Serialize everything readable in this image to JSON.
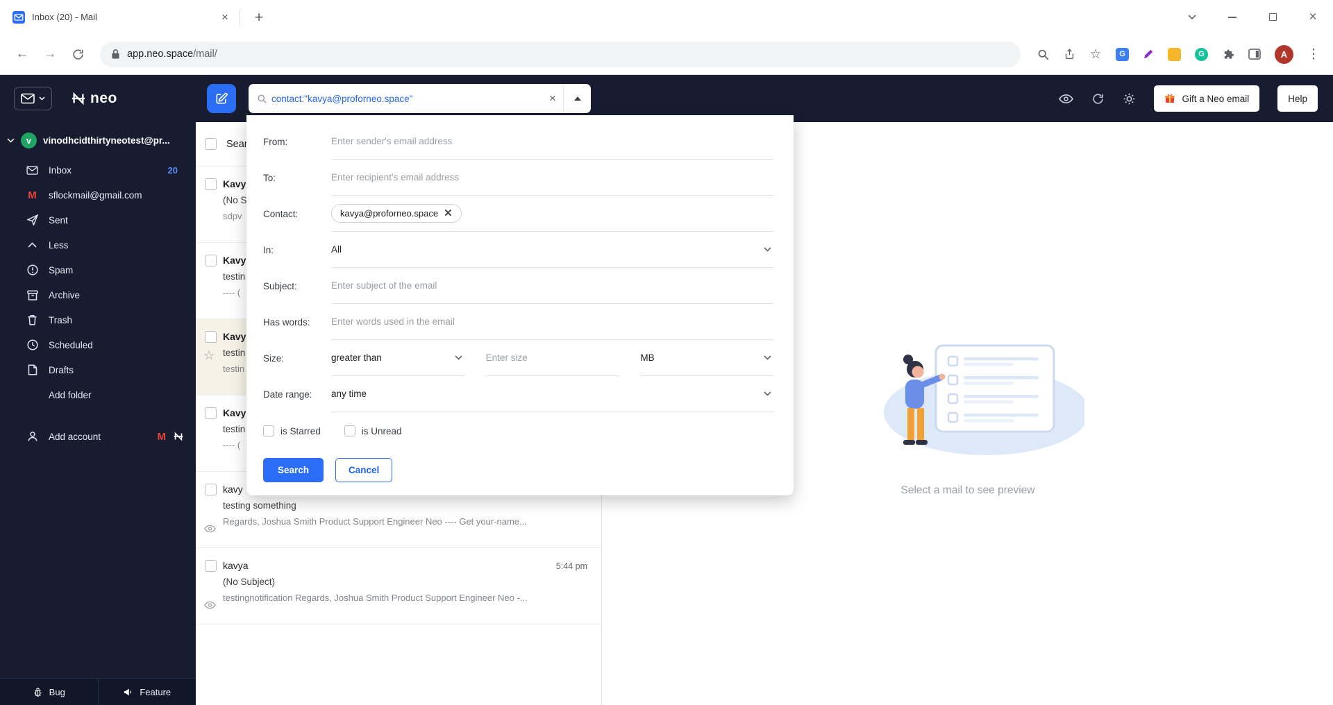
{
  "browser": {
    "tab_title": "Inbox (20) - Mail",
    "url_domain": "app.neo.space",
    "url_path": "/mail/",
    "profile_letter": "A"
  },
  "header": {
    "logo_text": "neo",
    "search_query": "contact:\"kavya@proforneo.space\"",
    "gift_button_label": "Gift a Neo email",
    "help_button_label": "Help"
  },
  "sidebar": {
    "account_email": "vinodhcidthirtyneotest@pr...",
    "account_avatar_letter": "v",
    "items": [
      {
        "label": "Inbox",
        "badge": "20"
      },
      {
        "label": "sflockmail@gmail.com"
      },
      {
        "label": "Sent"
      },
      {
        "label": "Less"
      },
      {
        "label": "Spam"
      },
      {
        "label": "Archive"
      },
      {
        "label": "Trash"
      },
      {
        "label": "Scheduled"
      },
      {
        "label": "Drafts"
      },
      {
        "label": "Add folder"
      }
    ],
    "add_account_label": "Add account",
    "bug_label": "Bug",
    "feature_label": "Feature"
  },
  "mail_list": {
    "header_label": "Sear",
    "rows": [
      {
        "sender": "Kavy",
        "subject": "(No S",
        "snippet": "sdpv"
      },
      {
        "sender": "Kavy",
        "subject": "testin",
        "snippet": "---- ("
      },
      {
        "sender": "Kavy",
        "subject": "testin",
        "snippet": "testin",
        "selected": true,
        "starred": true
      },
      {
        "sender": "Kavy",
        "subject": "testin",
        "snippet": "---- ("
      },
      {
        "sender": "kavy",
        "subject": "testing something",
        "snippet": "Regards, Joshua Smith Product Support Engineer Neo ---- Get your-name...",
        "read_receipt": true
      },
      {
        "sender": "kavya",
        "subject": "(No Subject)",
        "snippet": "testingnotification Regards, Joshua Smith Product Support Engineer Neo -...",
        "time": "5:44 pm",
        "read_receipt": true
      }
    ]
  },
  "search_panel": {
    "from_label": "From:",
    "from_placeholder": "Enter sender's email address",
    "to_label": "To:",
    "to_placeholder": "Enter recipient's email address",
    "contact_label": "Contact:",
    "contact_chip": "kavya@proforneo.space",
    "in_label": "In:",
    "in_value": "All",
    "subject_label": "Subject:",
    "subject_placeholder": "Enter subject of the email",
    "haswords_label": "Has words:",
    "haswords_placeholder": "Enter words used in the email",
    "size_label": "Size:",
    "size_operator": "greater than",
    "size_placeholder": "Enter size",
    "size_unit": "MB",
    "daterange_label": "Date range:",
    "daterange_value": "any time",
    "starred_label": "is Starred",
    "unread_label": "is Unread",
    "search_button": "Search",
    "cancel_button": "Cancel"
  },
  "preview": {
    "empty_text": "Select a mail to see preview"
  },
  "colors": {
    "accent_blue": "#2b6ef5",
    "dark_navy": "#171c30",
    "selected_row": "#f7f2e7"
  }
}
